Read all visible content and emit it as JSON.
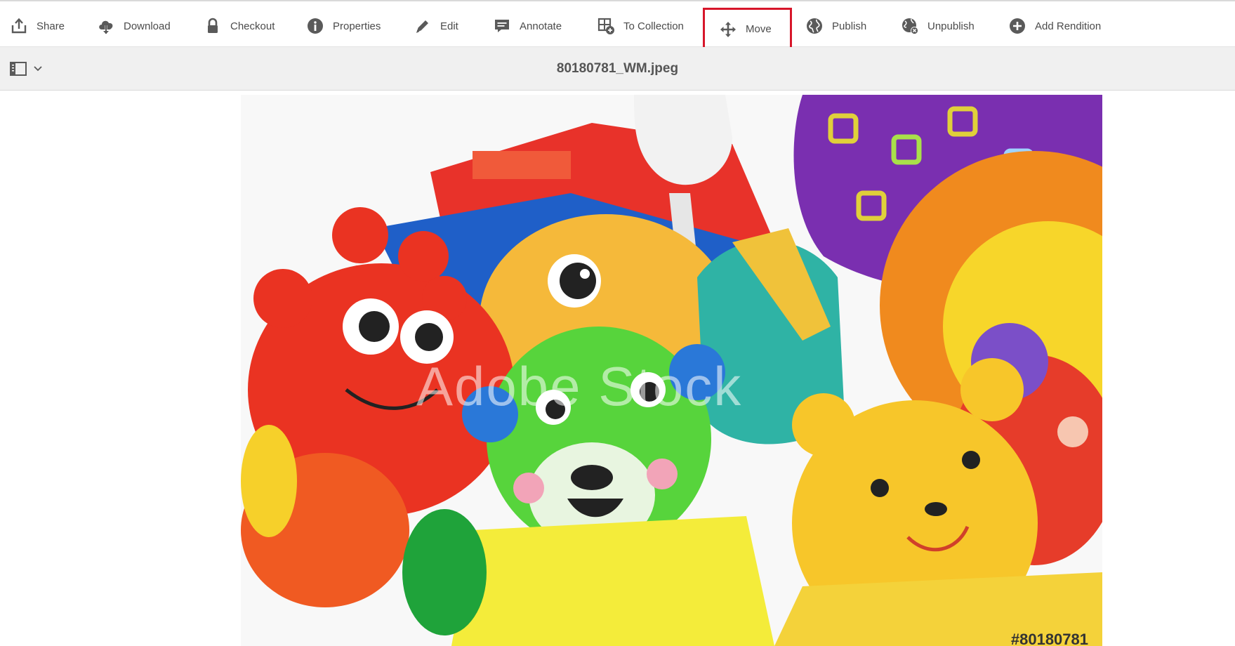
{
  "toolbar": {
    "actions": [
      {
        "id": "share",
        "label": "Share",
        "icon": "share-icon"
      },
      {
        "id": "download",
        "label": "Download",
        "icon": "cloud-download-icon"
      },
      {
        "id": "checkout",
        "label": "Checkout",
        "icon": "lock-icon"
      },
      {
        "id": "properties",
        "label": "Properties",
        "icon": "info-icon"
      },
      {
        "id": "edit",
        "label": "Edit",
        "icon": "pencil-icon"
      },
      {
        "id": "annotate",
        "label": "Annotate",
        "icon": "comment-icon"
      },
      {
        "id": "to_collection",
        "label": "To Collection",
        "icon": "add-to-collection-icon"
      },
      {
        "id": "move",
        "label": "Move",
        "icon": "move-icon",
        "highlighted": true
      },
      {
        "id": "publish",
        "label": "Publish",
        "icon": "globe-icon"
      },
      {
        "id": "unpublish",
        "label": "Unpublish",
        "icon": "globe-remove-icon"
      },
      {
        "id": "add_rendition",
        "label": "Add Rendition",
        "icon": "plus-circle-icon"
      }
    ],
    "highlight_color": "#d7162a"
  },
  "header": {
    "rail_toggle_icon": "side-panel-icon",
    "dropdown_icon": "chevron-down-icon",
    "file_name": "80180781_WM.jpeg"
  },
  "preview": {
    "watermark_text": "Adobe Stock",
    "stock_id": "#80180781"
  }
}
